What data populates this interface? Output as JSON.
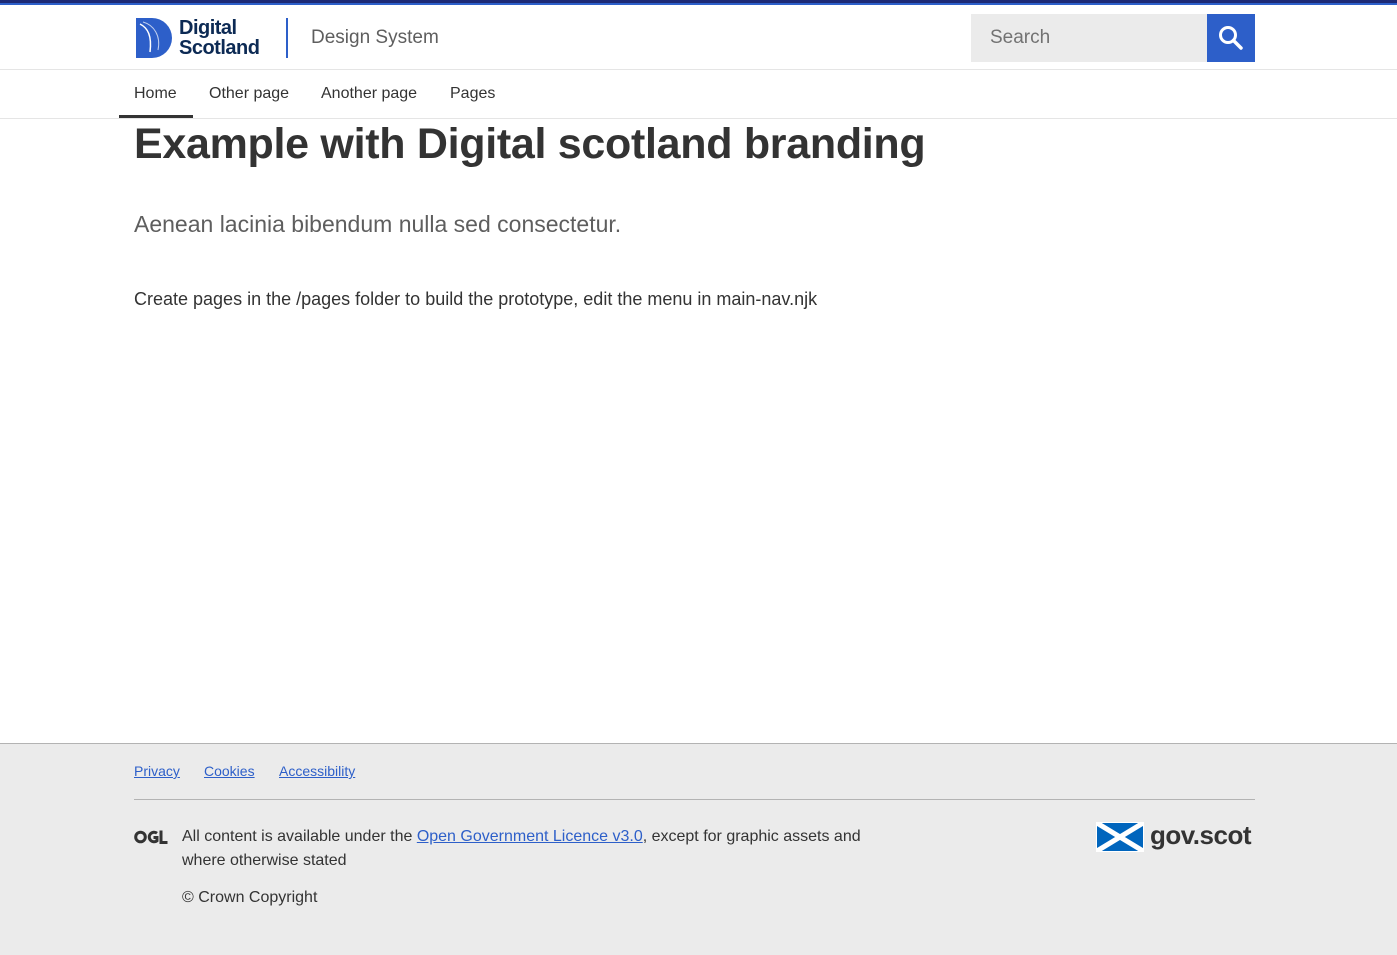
{
  "header": {
    "logo_line1": "Digital",
    "logo_line2": "Scotland",
    "site_title": "Design System",
    "search_placeholder": "Search",
    "search_button_label": "Search"
  },
  "nav": {
    "items": [
      {
        "label": "Home",
        "active": true
      },
      {
        "label": "Other page",
        "active": false
      },
      {
        "label": "Another page",
        "active": false
      },
      {
        "label": "Pages",
        "active": false
      }
    ]
  },
  "main": {
    "title": "Example with Digital scotland branding",
    "lede": "Aenean lacinia bibendum nulla sed consectetur.",
    "body": "Create pages in the /pages folder to build the prototype, edit the menu in main-nav.njk"
  },
  "footer": {
    "links": [
      "Privacy",
      "Cookies",
      "Accessibility"
    ],
    "ogl_label": "OGL",
    "licence_prefix": "All content is available under the ",
    "licence_link": "Open Government Licence v3.0",
    "licence_suffix": ", except for graphic assets and where otherwise stated",
    "copyright": "© Crown Copyright",
    "govscot_label": "gov.scot"
  },
  "colors": {
    "brand_blue": "#2d5fc9",
    "dark_navy": "#0c2a54",
    "text": "#333333",
    "footer_bg": "#ebebeb"
  }
}
